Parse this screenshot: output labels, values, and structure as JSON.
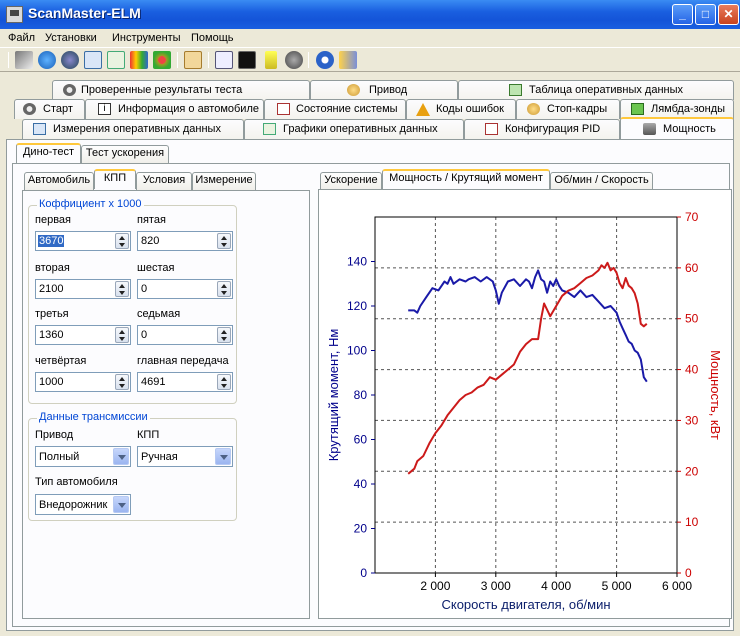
{
  "window": {
    "title": "ScanMaster-ELM"
  },
  "menu": [
    "Файл",
    "Установки",
    "Инструменты",
    "Помощь"
  ],
  "toolbar_icons": [
    "wrench-icon",
    "globe-icon",
    "info-car-icon",
    "table-icon",
    "graph-icon",
    "diagnostics-icon",
    "dtc-icon",
    "clipboard-icon",
    "monitor-icon",
    "terminal-icon",
    "battery-icon",
    "stop-icon",
    "about-icon",
    "exit-icon"
  ],
  "tabs": {
    "row1": [
      "Проверенные результаты теста",
      "Привод",
      "Таблица оперативных данных"
    ],
    "row2": [
      "Старт",
      "Информация о автомобиле",
      "Состояние системы",
      "Коды ошибок",
      "Стоп-кадры",
      "Лямбда-зонды"
    ],
    "row3": [
      "Измерения оперативных данных",
      "Графики оперативных данных",
      "Конфигурация PID",
      "Мощность"
    ]
  },
  "dyno_tabs": [
    "Дино-тест",
    "Тест ускорения"
  ],
  "left_tabs": [
    "Автомобиль",
    "КПП",
    "Условия",
    "Измерение"
  ],
  "gears": {
    "group_title": "Коффициент x 1000",
    "fields": [
      {
        "label": "первая",
        "value": "3670"
      },
      {
        "label": "пятая",
        "value": "820"
      },
      {
        "label": "вторая",
        "value": "2100"
      },
      {
        "label": "шестая",
        "value": "0"
      },
      {
        "label": "третья",
        "value": "1360"
      },
      {
        "label": "седьмая",
        "value": "0"
      },
      {
        "label": "четвёртая",
        "value": "1000"
      },
      {
        "label": "главная передача",
        "value": "4691"
      }
    ]
  },
  "transmission": {
    "group_title": "Данные трансмиссии",
    "drive_label": "Привод",
    "drive_value": "Полный",
    "gearbox_label": "КПП",
    "gearbox_value": "Ручная",
    "vehicle_type_label": "Тип автомобиля",
    "vehicle_type_value": "Внедорожник"
  },
  "chart_tabs": [
    "Ускорение",
    "Мощность / Крутящий момент",
    "Об/мин / Скорость"
  ],
  "colors": {
    "torque": "#1a1aa8",
    "power": "#cc1a1a",
    "tab_highlight": "#ffc83c",
    "accent": "#0046d5"
  },
  "chart_data": {
    "type": "line",
    "xlabel": "Скорость двигателя, об/мин",
    "ylabel_left": "Крутящий момент, Нм",
    "ylabel_right": "Мощность, кВт",
    "xlim": [
      1000,
      6000
    ],
    "ylim_left": [
      0,
      160
    ],
    "ylim_right": [
      0,
      70
    ],
    "x_ticks": [
      "2 000",
      "3 000",
      "4 000",
      "5 000",
      "6 000"
    ],
    "y_left_ticks": [
      "0",
      "20",
      "40",
      "60",
      "80",
      "100",
      "120",
      "140"
    ],
    "y_right_ticks": [
      "0",
      "10",
      "20",
      "30",
      "40",
      "50",
      "60",
      "70"
    ],
    "grid": true,
    "series": [
      {
        "axis": "left",
        "x": [
          1550,
          1650,
          1700,
          1750,
          1850,
          1950,
          2050,
          2150,
          2200,
          2250,
          2300,
          2400,
          2500,
          2550,
          2650,
          2750,
          2850,
          2950,
          3000,
          3050,
          3100,
          3200,
          3300,
          3400,
          3500,
          3550,
          3600,
          3650,
          3700,
          3750,
          3800,
          3850,
          3900,
          3950,
          4000,
          4050,
          4100,
          4200,
          4300,
          4400,
          4500,
          4600,
          4700,
          4800,
          4900,
          5000,
          5050,
          5100,
          5150,
          5200,
          5250,
          5300,
          5350,
          5400,
          5450,
          5500
        ],
        "values": [
          118,
          118,
          117,
          120,
          124,
          128,
          127,
          131,
          130,
          133,
          130,
          132,
          131,
          132,
          133,
          131,
          133,
          131,
          127,
          121,
          126,
          131,
          132,
          129,
          132,
          131,
          128,
          133,
          136,
          132,
          131,
          126,
          131,
          129,
          132,
          129,
          127,
          126,
          124,
          127,
          124,
          125,
          122,
          119,
          120,
          117,
          113,
          110,
          107,
          104,
          103,
          100,
          99,
          96,
          88,
          86
        ]
      },
      {
        "axis": "right",
        "x": [
          1550,
          1600,
          1650,
          1700,
          1800,
          1900,
          2000,
          2100,
          2200,
          2300,
          2400,
          2500,
          2600,
          2700,
          2800,
          2900,
          3000,
          3100,
          3200,
          3300,
          3400,
          3500,
          3600,
          3700,
          3750,
          3800,
          3900,
          4000,
          4100,
          4200,
          4300,
          4400,
          4500,
          4600,
          4700,
          4750,
          4800,
          4850,
          4900,
          4950,
          5000,
          5050,
          5100,
          5150,
          5200,
          5250,
          5300,
          5350,
          5400,
          5450,
          5500
        ],
        "values": [
          19.5,
          20,
          20.5,
          22,
          23,
          25.5,
          27.5,
          29,
          31,
          32.5,
          34,
          35,
          35.5,
          36.5,
          37,
          38.5,
          38,
          39,
          40,
          41,
          43.5,
          45,
          46,
          46,
          50,
          53,
          50.5,
          52.5,
          54.5,
          55.5,
          56,
          57,
          58,
          58.5,
          59.5,
          60.5,
          60,
          61,
          59.5,
          60,
          59,
          57,
          56,
          58,
          56.5,
          56,
          55,
          53,
          49,
          48.5,
          49
        ]
      }
    ]
  }
}
